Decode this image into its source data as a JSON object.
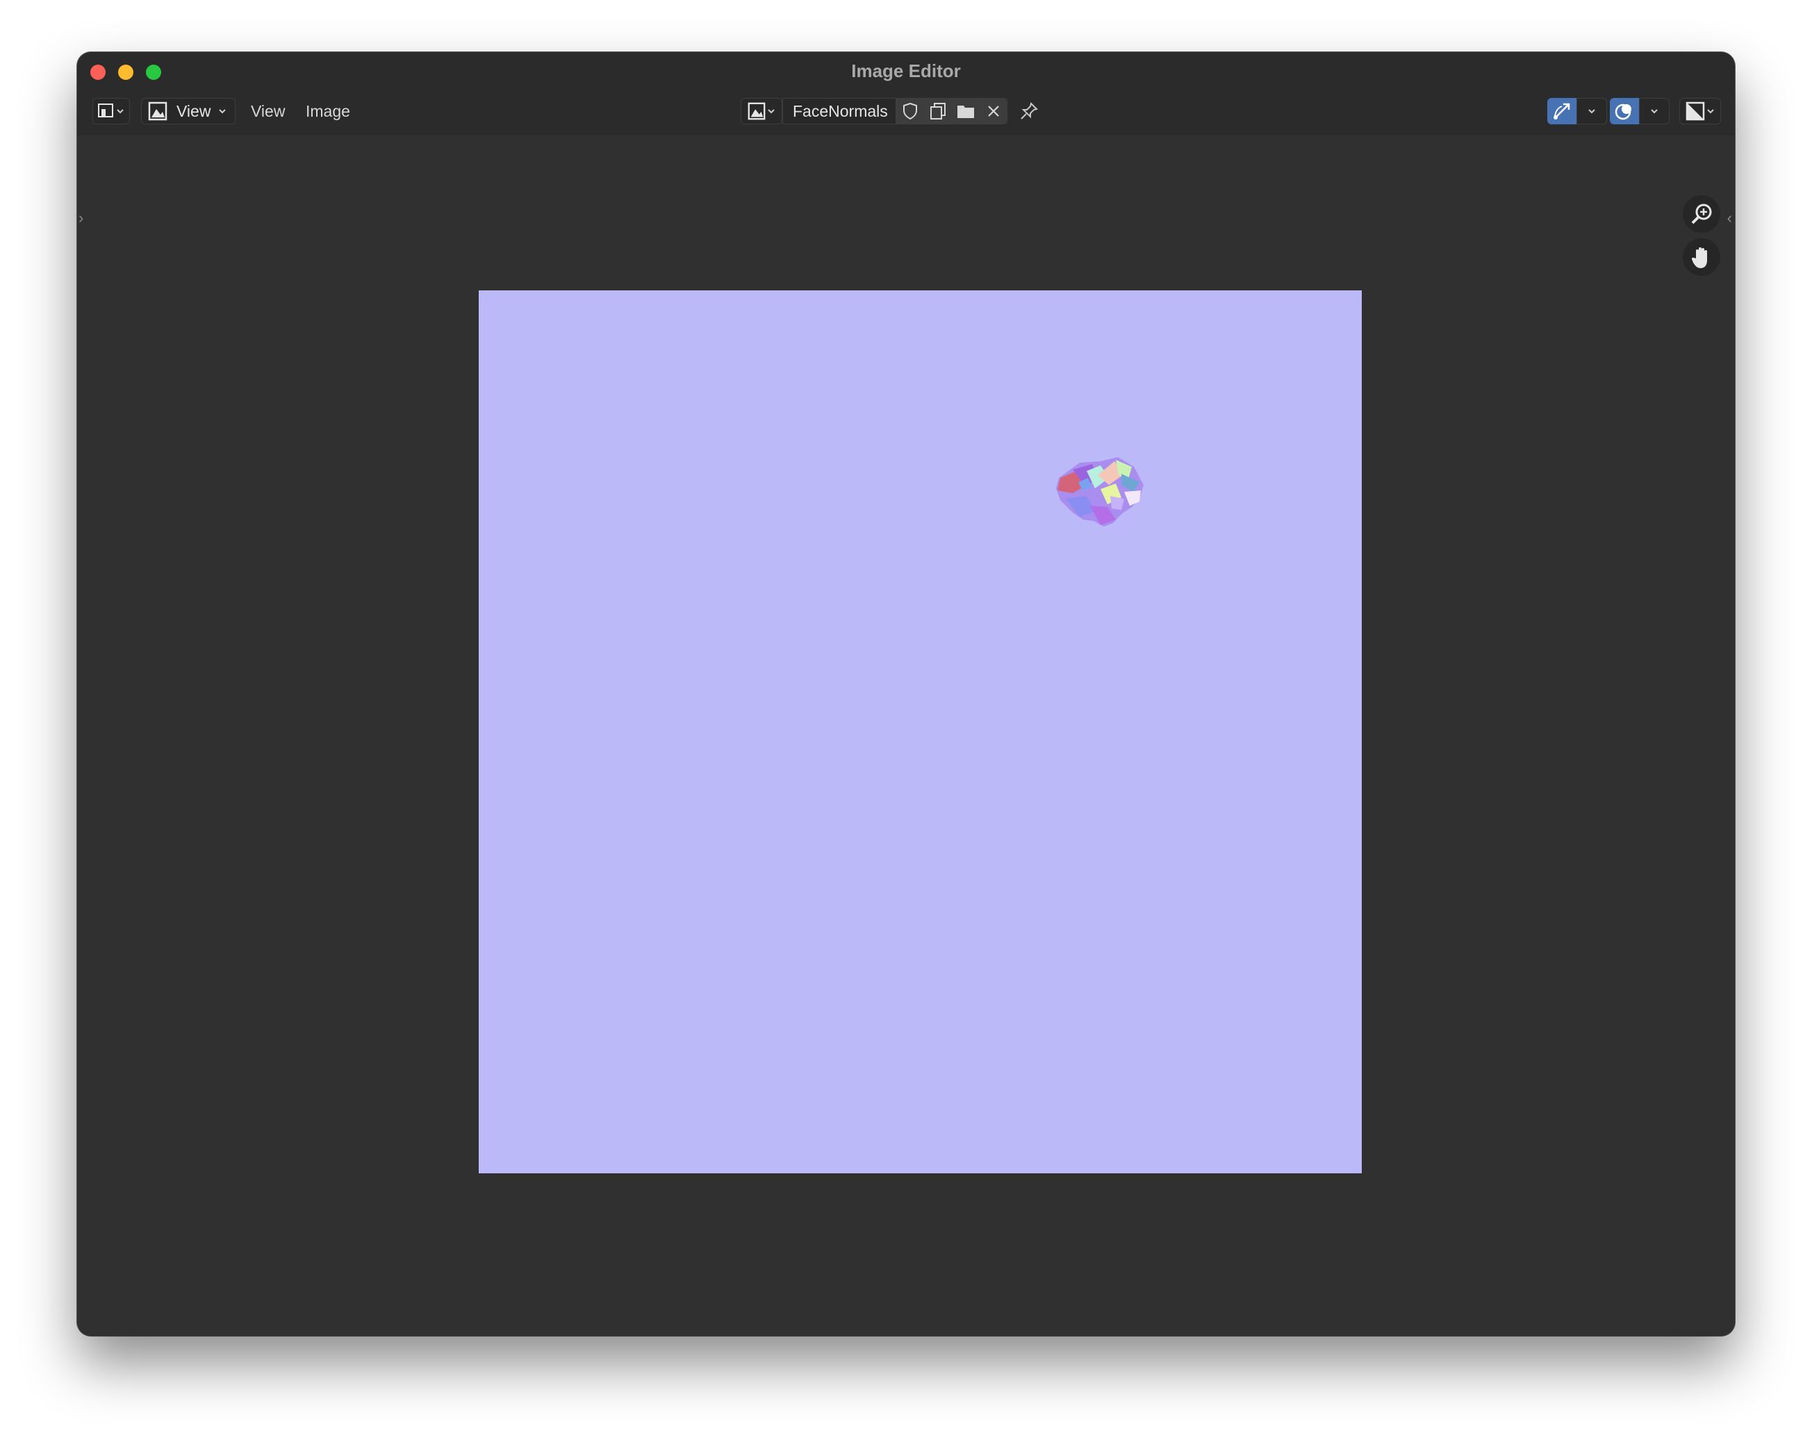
{
  "window": {
    "title": "Image Editor"
  },
  "header": {
    "editor_type_icon": "image-editor-icon",
    "mode_label": "View",
    "menus": [
      "View",
      "Image"
    ],
    "image_name": "FaceNormals",
    "image_actions": [
      "fake-user-shield-icon",
      "duplicate-image-icon",
      "open-image-folder-icon",
      "unlink-image-close-icon"
    ],
    "pin_icon": "pin-icon",
    "gizmo_icon": "gizmo-icon",
    "overlay_icon": "overlay-icon",
    "display_channels_icon": "display-channels-icon"
  },
  "navigation": {
    "zoom_icon": "zoom-icon",
    "pan_icon": "pan-hand-icon"
  },
  "canvas": {
    "image_background": "#bcb9f9"
  }
}
